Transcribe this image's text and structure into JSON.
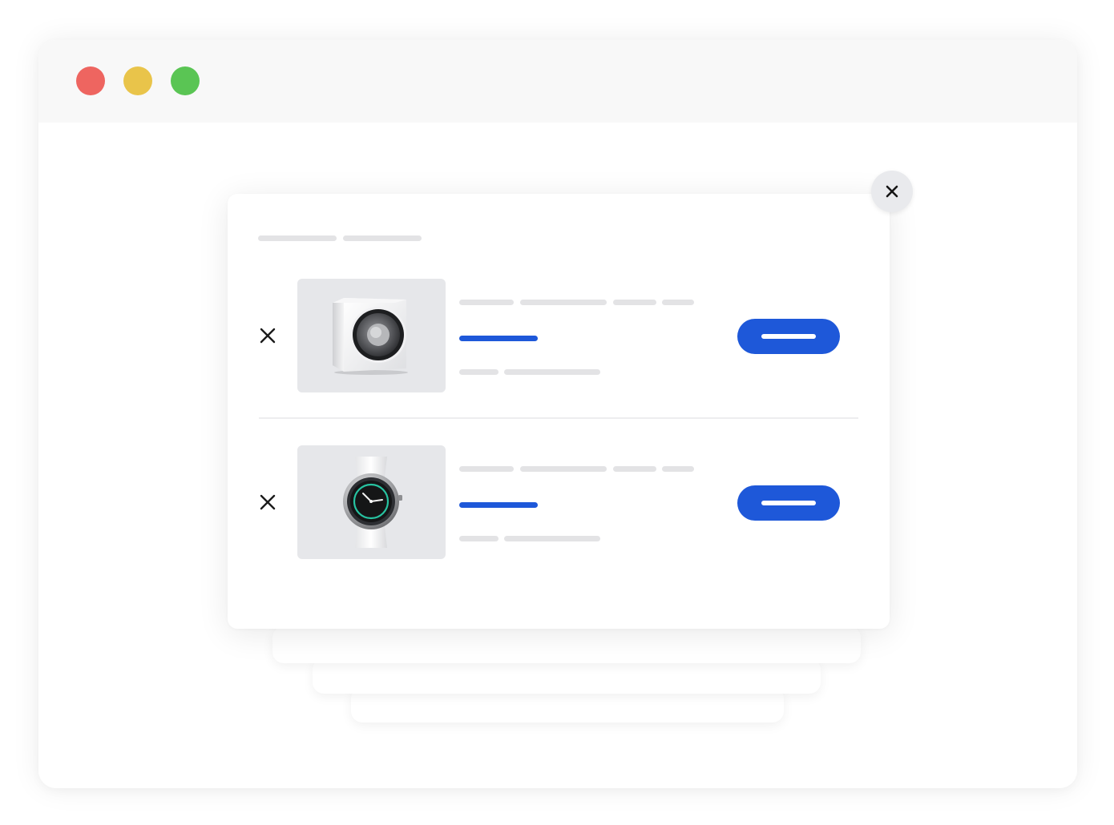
{
  "window": {
    "controls": [
      {
        "name": "close-window-dot",
        "color": "#ee6560"
      },
      {
        "name": "minimize-window-dot",
        "color": "#e9c44a"
      },
      {
        "name": "maximize-window-dot",
        "color": "#5ac554"
      }
    ]
  },
  "modal": {
    "close_icon": "close-icon",
    "items": [
      {
        "product_image": "subwoofer-speaker-image",
        "remove_icon": "remove-x-icon"
      },
      {
        "product_image": "smartwatch-image",
        "remove_icon": "remove-x-icon"
      }
    ]
  },
  "colors": {
    "accent": "#1e58d9",
    "placeholder": "#e3e3e5",
    "thumb_bg": "#e6e7ea"
  }
}
